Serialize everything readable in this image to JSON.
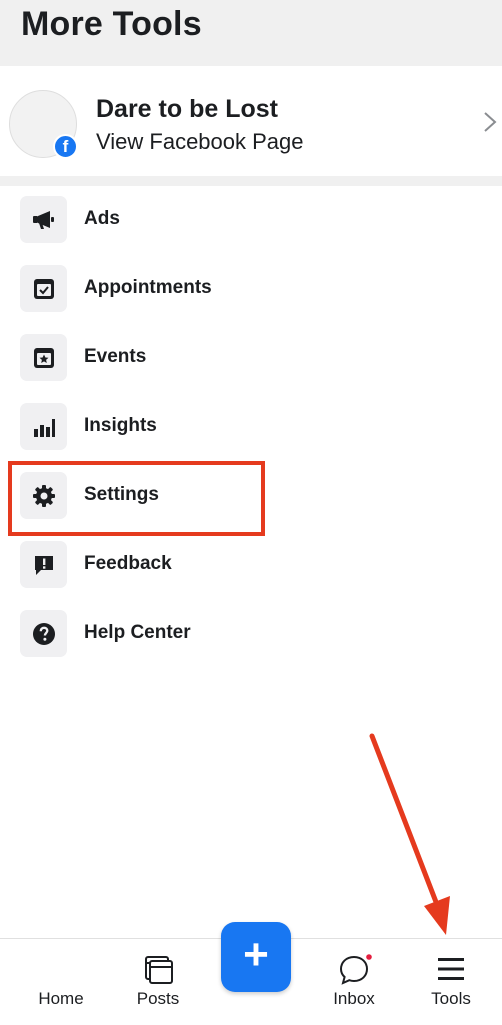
{
  "header": {
    "title": "More Tools"
  },
  "page": {
    "name": "Dare to be Lost",
    "subtitle": "View Facebook Page",
    "badge": "f"
  },
  "menu": {
    "items": [
      {
        "label": "Ads",
        "icon": "megaphone-icon"
      },
      {
        "label": "Appointments",
        "icon": "calendar-check-icon"
      },
      {
        "label": "Events",
        "icon": "calendar-star-icon"
      },
      {
        "label": "Insights",
        "icon": "bar-chart-icon"
      },
      {
        "label": "Settings",
        "icon": "gear-icon"
      },
      {
        "label": "Feedback",
        "icon": "exclamation-bubble-icon"
      },
      {
        "label": "Help Center",
        "icon": "question-circle-icon"
      }
    ]
  },
  "bottom_nav": {
    "items": [
      {
        "label": "Home",
        "icon": "home-icon"
      },
      {
        "label": "Posts",
        "icon": "posts-icon"
      },
      {
        "label": "Inbox",
        "icon": "chat-bubble-icon",
        "unread_dot": true
      },
      {
        "label": "Tools",
        "icon": "hamburger-icon"
      }
    ],
    "create_label": "+"
  },
  "colors": {
    "brand_blue": "#1877f2",
    "annotation_red": "#e53a1e",
    "icon_bg": "#f0f0f2",
    "text": "#1c1e21"
  }
}
